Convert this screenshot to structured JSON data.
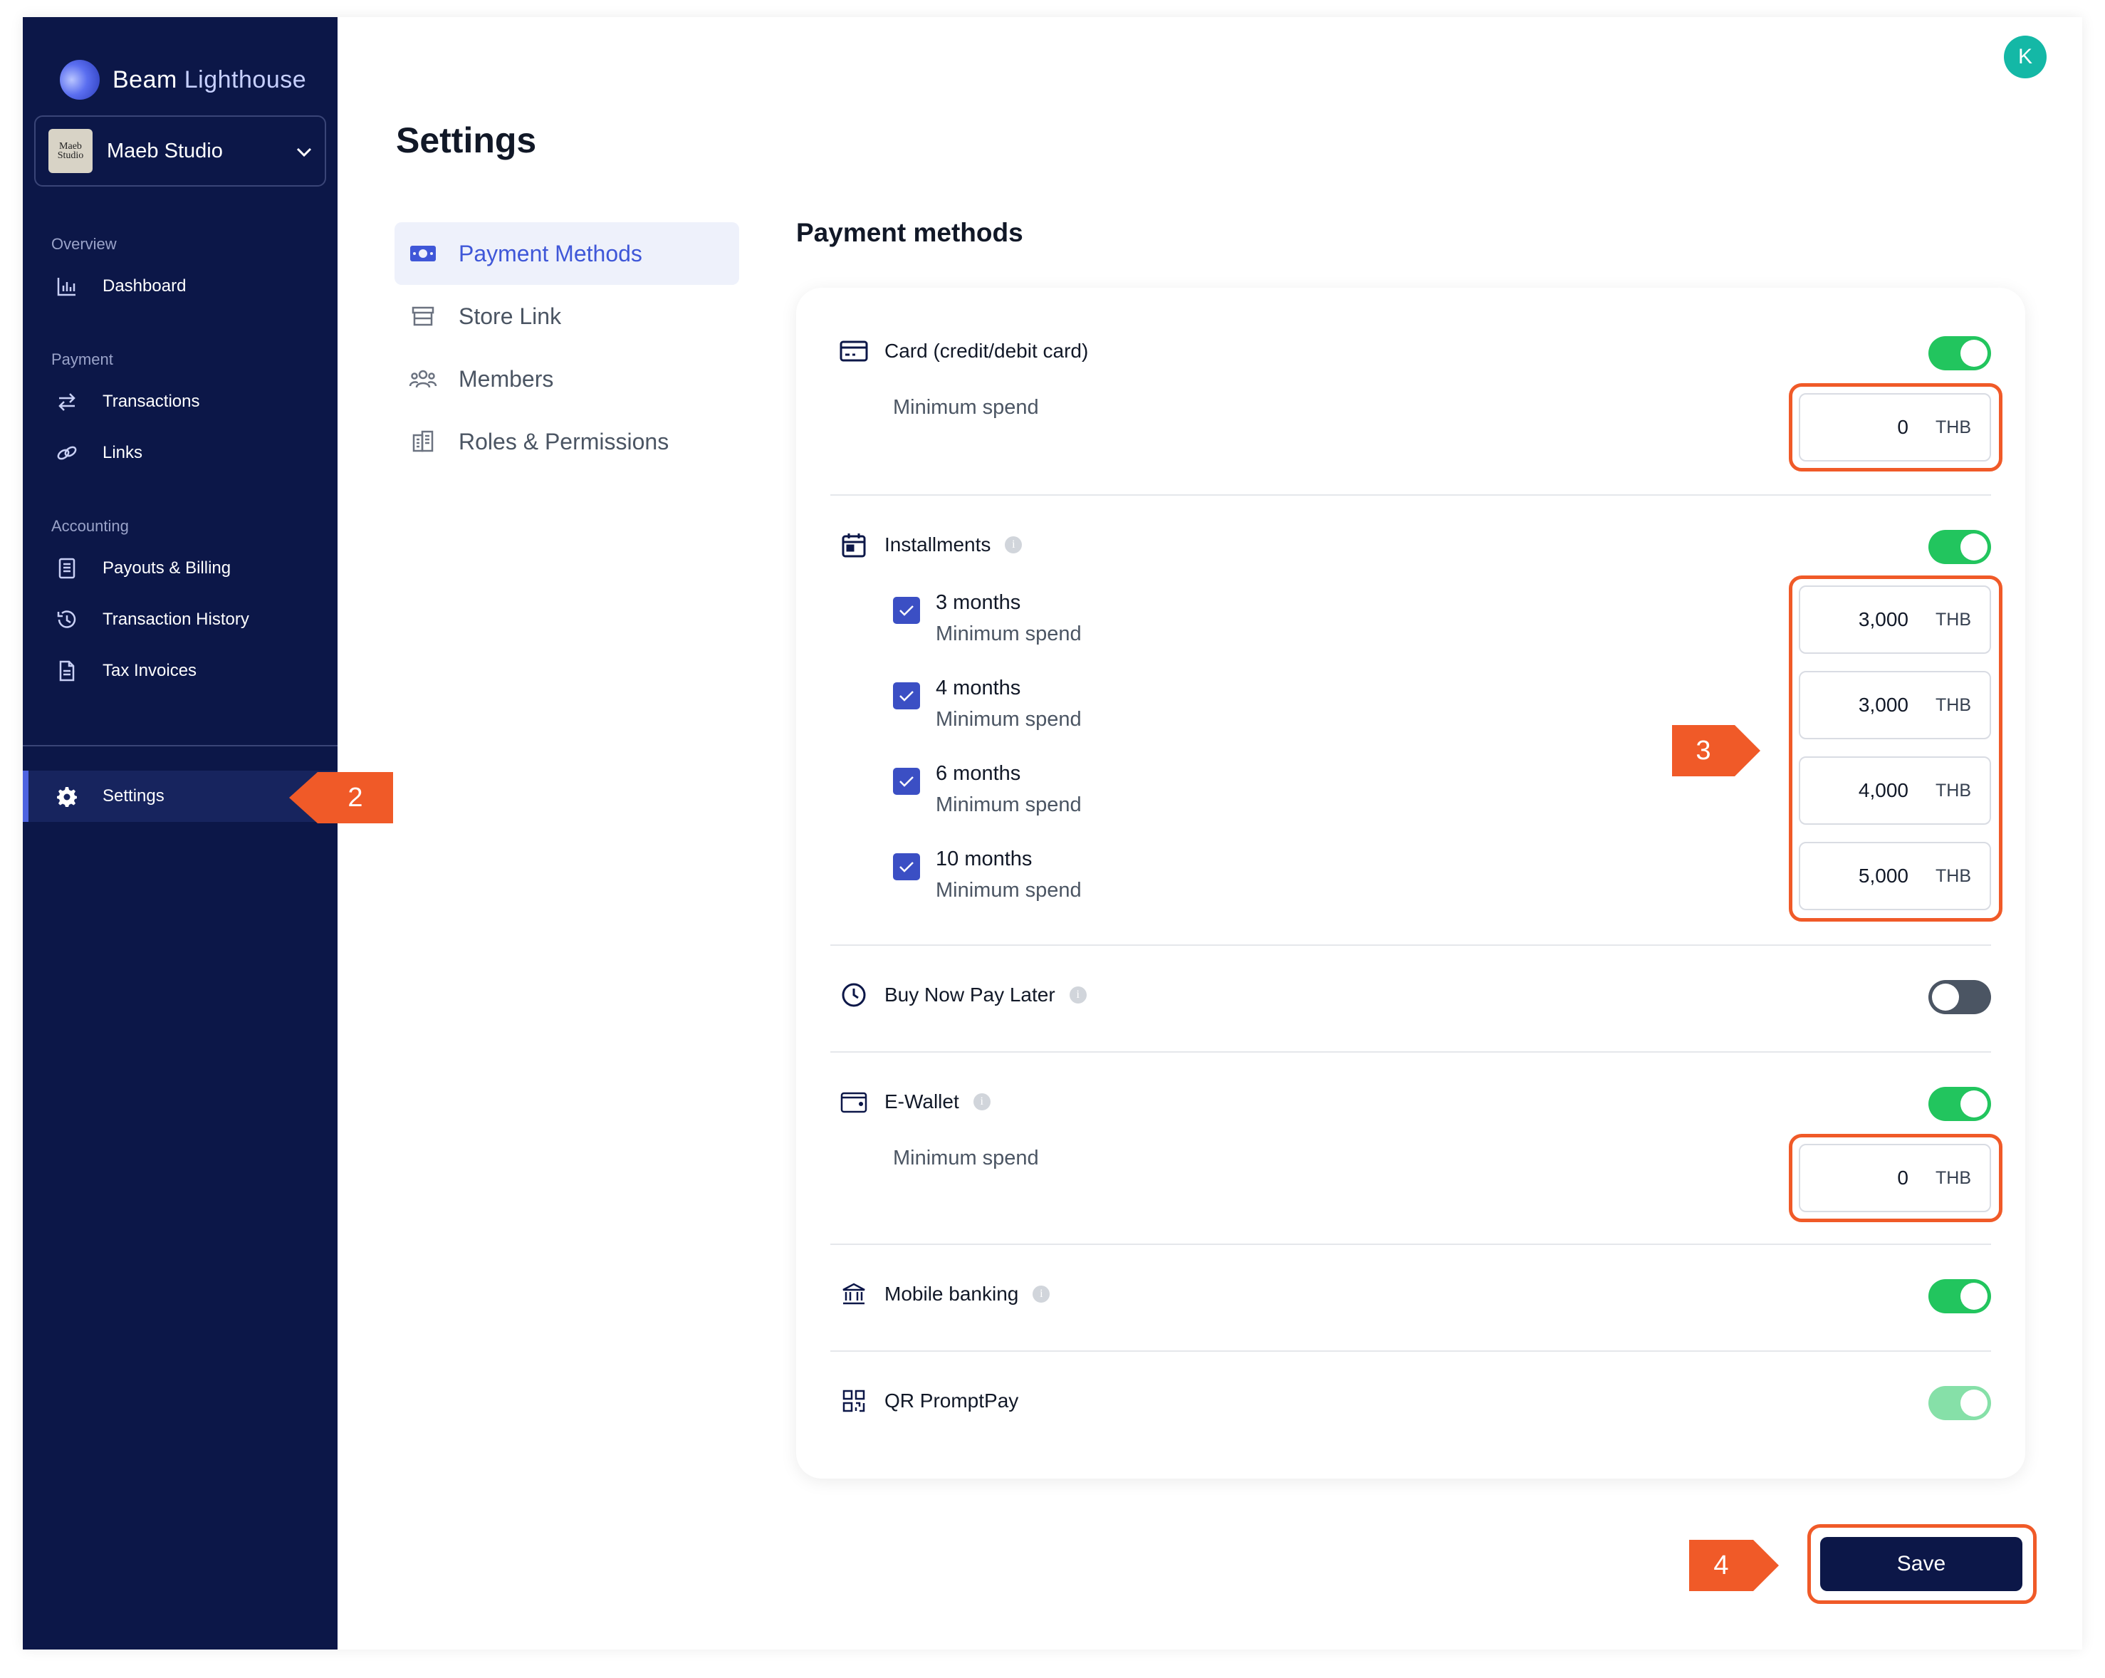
{
  "brand": {
    "name_part1": "Beam",
    "name_part2": " Lighthouse"
  },
  "org": {
    "name": "Maeb Studio",
    "avatar_text": "Maeb Studio"
  },
  "sidebar": {
    "sections": [
      {
        "label": "Overview"
      },
      {
        "label": "Payment"
      },
      {
        "label": "Accounting"
      }
    ],
    "items": [
      {
        "label": "Dashboard",
        "icon": "bar-chart-icon"
      },
      {
        "label": "Transactions",
        "icon": "swap-arrows-icon"
      },
      {
        "label": "Links",
        "icon": "link-icon"
      },
      {
        "label": "Payouts & Billing",
        "icon": "receipt-icon"
      },
      {
        "label": "Transaction History",
        "icon": "history-icon"
      },
      {
        "label": "Tax Invoices",
        "icon": "document-icon"
      },
      {
        "label": "Settings",
        "icon": "gear-icon"
      }
    ]
  },
  "user": {
    "initial": "K"
  },
  "page": {
    "title": "Settings"
  },
  "subnav": [
    {
      "label": "Payment Methods",
      "icon": "money-icon"
    },
    {
      "label": "Store Link",
      "icon": "store-icon"
    },
    {
      "label": "Members",
      "icon": "users-icon"
    },
    {
      "label": "Roles & Permissions",
      "icon": "building-icon"
    }
  ],
  "main": {
    "section_title": "Payment methods",
    "min_spend_label": "Minimum spend",
    "currency": "THB",
    "card": {
      "label": "Card (credit/debit card)",
      "enabled": true,
      "min_spend": "0"
    },
    "installments": {
      "label": "Installments",
      "enabled": true,
      "plans": [
        {
          "label": "3 months",
          "checked": true,
          "min_spend": "3,000"
        },
        {
          "label": "4 months",
          "checked": true,
          "min_spend": "3,000"
        },
        {
          "label": "6 months",
          "checked": true,
          "min_spend": "4,000"
        },
        {
          "label": "10 months",
          "checked": true,
          "min_spend": "5,000"
        }
      ]
    },
    "bnpl": {
      "label": "Buy Now Pay Later",
      "enabled": false
    },
    "ewallet": {
      "label": "E-Wallet",
      "enabled": true,
      "min_spend": "0"
    },
    "mobile_banking": {
      "label": "Mobile banking",
      "enabled": true
    },
    "qr": {
      "label": "QR PromptPay",
      "enabled": true,
      "disabled": true
    },
    "save_label": "Save"
  },
  "callouts": {
    "c2": "2",
    "c3": "3",
    "c4": "4"
  },
  "colors": {
    "sidebar": "#0c1748",
    "accent": "#3f57d8",
    "toggle_on": "#22c55e",
    "callout": "#f05a28"
  }
}
